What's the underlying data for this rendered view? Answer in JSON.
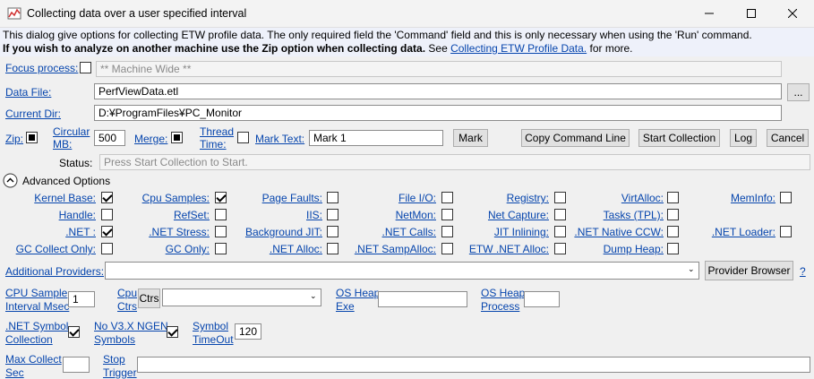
{
  "window": {
    "title": "Collecting data over a user specified interval"
  },
  "info": {
    "line1": "This dialog give options for collecting ETW profile data. The only required field the 'Command' field and this is only necessary when using the 'Run' command.",
    "line2_bold": "If you wish to analyze on another machine use the Zip option when collecting data.",
    "line2_see": " See ",
    "line2_link": "Collecting ETW Profile Data.",
    "line2_tail": " for more."
  },
  "focus": {
    "label": "Focus process:",
    "value": "** Machine Wide **"
  },
  "data_file": {
    "label": "Data File:",
    "value": "PerfViewData.etl",
    "browse": "..."
  },
  "current_dir": {
    "label": "Current Dir:",
    "value": "D:¥ProgramFiles¥PC_Monitor"
  },
  "options_row": {
    "zip": "Zip:",
    "circular_mb_1": "Circular",
    "circular_mb_2": "MB:",
    "circular_value": "500",
    "merge": "Merge:",
    "thread_time_1": "Thread",
    "thread_time_2": "Time:",
    "mark_text": "Mark Text:",
    "mark_value": "Mark 1",
    "mark_button": "Mark",
    "copy_button": "Copy Command Line",
    "start_button": "Start Collection",
    "log_button": "Log",
    "cancel_button": "Cancel"
  },
  "status": {
    "label": "Status:",
    "value": "Press Start Collection to Start."
  },
  "advanced": {
    "label": "Advanced Options"
  },
  "providers": [
    [
      {
        "label": "Kernel Base:",
        "checked": true
      },
      {
        "label": "Cpu Samples:",
        "checked": true
      },
      {
        "label": "Page Faults:",
        "checked": false
      },
      {
        "label": "File I/O:",
        "checked": false
      },
      {
        "label": "Registry:",
        "checked": false
      },
      {
        "label": "VirtAlloc:",
        "checked": false
      },
      {
        "label": "MemInfo:",
        "checked": false
      }
    ],
    [
      {
        "label": "Handle:",
        "checked": false
      },
      {
        "label": "RefSet:",
        "checked": false
      },
      {
        "label": "IIS:",
        "checked": false
      },
      {
        "label": "NetMon:",
        "checked": false
      },
      {
        "label": "Net Capture:",
        "checked": false
      },
      {
        "label": "Tasks (TPL):",
        "checked": false
      }
    ],
    [
      {
        "label": ".NET :",
        "checked": true
      },
      {
        "label": ".NET Stress:",
        "checked": false
      },
      {
        "label": "Background JIT:",
        "checked": false
      },
      {
        "label": ".NET Calls:",
        "checked": false
      },
      {
        "label": "JIT Inlining:",
        "checked": false
      },
      {
        "label": ".NET Native CCW:",
        "checked": false
      },
      {
        "label": ".NET Loader:",
        "checked": false
      }
    ],
    [
      {
        "label": "GC Collect Only:",
        "checked": false
      },
      {
        "label": "GC Only:",
        "checked": false
      },
      {
        "label": ".NET Alloc:",
        "checked": false
      },
      {
        "label": ".NET SampAlloc:",
        "checked": false
      },
      {
        "label": "ETW .NET Alloc:",
        "checked": false
      },
      {
        "label": "Dump Heap:",
        "checked": false
      }
    ]
  ],
  "additional_providers": {
    "label": "Additional Providers:",
    "value": "",
    "browser_button": "Provider Browser",
    "help": "?"
  },
  "cpu_sample": {
    "label_1": "CPU Sample",
    "label_2": "Interval Msec",
    "value": "1"
  },
  "cpu_ctrs": {
    "label_1": "Cpu",
    "label_2": "Ctrs",
    "button": "Ctrs",
    "value": ""
  },
  "os_heap_exe": {
    "label_1": "OS Heap",
    "label_2": "Exe",
    "value": ""
  },
  "os_heap_process": {
    "label_1": "OS Heap",
    "label_2": "Process",
    "value": ""
  },
  "net_symbol": {
    "label_1": ".NET Symbol",
    "label_2": "Collection",
    "checked": true
  },
  "no_ngen": {
    "label_1": "No V3.X NGEN",
    "label_2": "Symbols",
    "checked": true
  },
  "symbol_timeout": {
    "label_1": "Symbol",
    "label_2": "TimeOut",
    "value": "120"
  },
  "max_collect": {
    "label_1": "Max Collect",
    "label_2": "Sec",
    "value": ""
  },
  "stop_trigger": {
    "label_1": "Stop",
    "label_2": "Trigger",
    "value": ""
  }
}
